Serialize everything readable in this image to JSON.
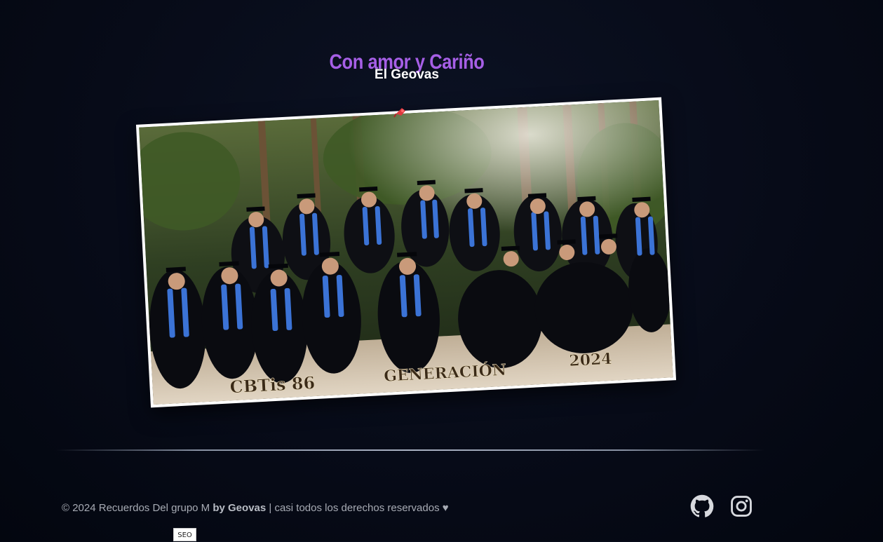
{
  "header": {
    "title": "Con amor y Cariño",
    "subtitle": "El Geovas"
  },
  "photo": {
    "caption_school": "CBTis 86",
    "caption_generation": "GENERACIÓN",
    "caption_year": "2024",
    "pin_icon": "pushpin-icon"
  },
  "footer": {
    "copyright_prefix": "© 2024 Recuerdos Del grupo M",
    "author": "by Geovas",
    "copyright_suffix": " | casi todos los derechos reservados ♥",
    "social": {
      "github_icon": "github-icon",
      "instagram_icon": "instagram-icon"
    }
  },
  "seo_badge": "SEO",
  "colors": {
    "title": "#a65fe6",
    "background": "#070b18",
    "footer_text": "#a7abb4"
  }
}
